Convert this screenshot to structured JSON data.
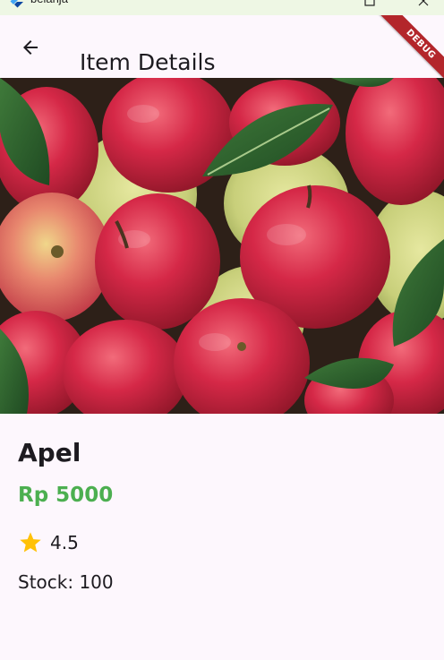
{
  "window": {
    "title": "belanja"
  },
  "appbar": {
    "title": "Item Details",
    "debug_label": "DEBUG"
  },
  "hero": {
    "image": "red-apples-photo"
  },
  "item": {
    "name": "Apel",
    "price": "Rp 5000",
    "rating": "4.5",
    "stock": "Stock: 100"
  },
  "colors": {
    "price": "#4caf50",
    "star": "#ffc107",
    "background": "#fdf7fd",
    "debug_ribbon": "#b3262b"
  },
  "icons": {
    "back": "arrow-left-icon",
    "rating": "star-icon"
  }
}
